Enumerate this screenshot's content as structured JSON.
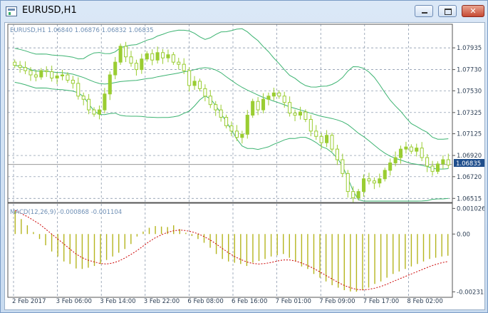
{
  "window": {
    "title": "EURUSD,H1"
  },
  "price_panel": {
    "header": "EURUSD,H1  1.06840 1.06876 1.06832 1.06835",
    "current_price_tag": "1.06835"
  },
  "macd_panel": {
    "header": "MACD(12,26,9) -0.000868 -0.001104"
  },
  "chart_data": [
    {
      "type": "candlestick",
      "symbol": "EURUSD",
      "timeframe": "H1",
      "last_ohlc": {
        "open": 1.0684,
        "high": 1.06876,
        "low": 1.06832,
        "close": 1.06835
      },
      "current_price": 1.06835,
      "y_ticks": [
        "1.07935",
        "1.07730",
        "1.07530",
        "1.07325",
        "1.07125",
        "1.06920",
        "1.06720",
        "1.06515"
      ],
      "x_ticks": [
        "2 Feb 2017",
        "3 Feb 06:00",
        "3 Feb 14:00",
        "3 Feb 22:00",
        "6 Feb 08:00",
        "6 Feb 16:00",
        "7 Feb 01:00",
        "7 Feb 09:00",
        "7 Feb 17:00",
        "8 Feb 02:00"
      ],
      "ylim": [
        1.0649,
        1.0805
      ],
      "grid": true,
      "indicators": [
        "Bollinger Bands (upper, middle, lower)"
      ],
      "closes": [
        1.0777,
        1.0775,
        1.0772,
        1.0768,
        1.0766,
        1.0772,
        1.0771,
        1.0765,
        1.0767,
        1.0768,
        1.0763,
        1.076,
        1.0748,
        1.0745,
        1.0735,
        1.0731,
        1.0735,
        1.075,
        1.0768,
        1.078,
        1.0795,
        1.0785,
        1.0779,
        1.0773,
        1.0783,
        1.0788,
        1.0782,
        1.0789,
        1.0784,
        1.0787,
        1.078,
        1.0778,
        1.0772,
        1.0758,
        1.0762,
        1.0755,
        1.0748,
        1.074,
        1.0735,
        1.0728,
        1.072,
        1.0715,
        1.0709,
        1.0712,
        1.073,
        1.0743,
        1.0735,
        1.0745,
        1.0748,
        1.0751,
        1.0748,
        1.0742,
        1.0732,
        1.073,
        1.0733,
        1.0726,
        1.0715,
        1.071,
        1.0704,
        1.0711,
        1.0698,
        1.0688,
        1.0675,
        1.0658,
        1.0652,
        1.0658,
        1.067,
        1.0668,
        1.0666,
        1.067,
        1.0678,
        1.0685,
        1.069,
        1.0698,
        1.07,
        1.0696,
        1.0699,
        1.069,
        1.0682,
        1.0677,
        1.0684,
        1.0688,
        1.0683
      ]
    },
    {
      "type": "bar+line",
      "title": "MACD(12,26,9)",
      "main": -0.000868,
      "signal": -0.001104,
      "y_ticks": [
        "0.001026",
        "0.00",
        "-0.002315"
      ],
      "ylim": [
        -0.00245,
        0.00115
      ],
      "macd_values": [
        0.00092,
        0.0006,
        0.00035,
        8e-05,
        -0.0002,
        -0.00045,
        -0.0007,
        -0.0009,
        -0.0011,
        -0.0012,
        -0.00138,
        -0.0014,
        -0.00135,
        -0.00128,
        -0.0012,
        -0.00104,
        -0.0009,
        -0.00075,
        -0.0006,
        -0.0004,
        -0.0001,
        0.0001,
        0.00025,
        0.00032,
        0.0003,
        0.00028,
        0.00035,
        0.0002,
        5e-05,
        -8e-05,
        -0.0002,
        -0.00035,
        -0.00055,
        -0.0008,
        -0.001,
        -0.0011,
        -0.00115,
        -0.0012,
        -0.00128,
        -0.00115,
        -0.00108,
        -0.001,
        -0.0009,
        -0.00085,
        -0.0008,
        -0.00095,
        -0.0011,
        -0.0013,
        -0.0014,
        -0.0016,
        -0.00175,
        -0.0019,
        -0.00205,
        -0.00215,
        -0.00225,
        -0.0023,
        -0.00231,
        -0.00225,
        -0.00215,
        -0.002,
        -0.0019,
        -0.00175,
        -0.0016,
        -0.0015,
        -0.0014,
        -0.0013,
        -0.0012,
        -0.0011,
        -0.001,
        -0.00095,
        -0.0009,
        -0.00087
      ],
      "signal_values": [
        0.00095,
        0.00082,
        0.0007,
        0.00055,
        0.0004,
        0.0002,
        0.0,
        -0.0002,
        -0.0004,
        -0.0006,
        -0.0008,
        -0.00095,
        -0.00105,
        -0.00112,
        -0.00118,
        -0.0012,
        -0.00116,
        -0.00108,
        -0.00096,
        -0.00082,
        -0.00066,
        -0.00048,
        -0.0003,
        -0.00015,
        -3e-05,
        7e-05,
        0.00013,
        0.00016,
        0.00014,
        9e-05,
        1e-05,
        -0.0001,
        -0.00024,
        -0.0004,
        -0.00058,
        -0.00075,
        -0.0009,
        -0.00102,
        -0.00112,
        -0.00118,
        -0.0012,
        -0.00118,
        -0.00114,
        -0.00108,
        -0.00104,
        -0.00104,
        -0.00108,
        -0.00116,
        -0.00126,
        -0.00138,
        -0.00152,
        -0.00166,
        -0.0018,
        -0.00194,
        -0.00206,
        -0.00215,
        -0.00222,
        -0.00224,
        -0.00222,
        -0.00217,
        -0.0021,
        -0.00201,
        -0.0019,
        -0.0018,
        -0.0017,
        -0.0016,
        -0.0015,
        -0.0014,
        -0.0013,
        -0.00122,
        -0.00115,
        -0.0011
      ]
    }
  ],
  "colors": {
    "candle": "#9acd32",
    "band": "#3cb371",
    "signal": "#cc0000",
    "grid": "#7a8aa0",
    "tag": "#1f4e8c"
  }
}
